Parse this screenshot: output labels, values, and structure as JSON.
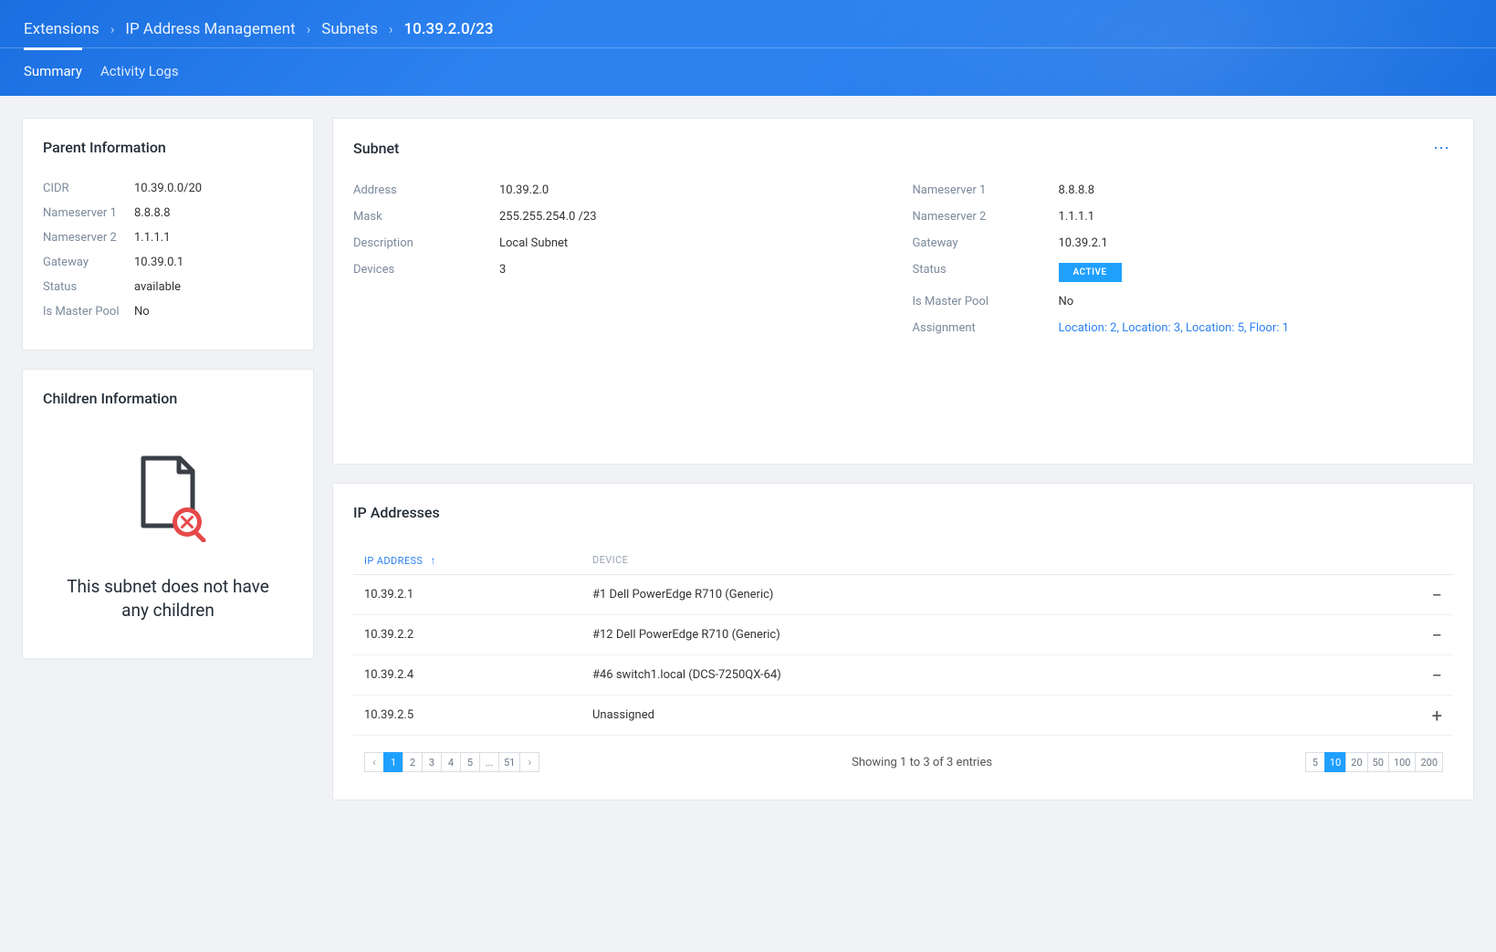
{
  "breadcrumbs": {
    "items": [
      "Extensions",
      "IP Address Management",
      "Subnets",
      "10.39.2.0/23"
    ]
  },
  "tabs": {
    "summary": "Summary",
    "activity": "Activity Logs"
  },
  "parent": {
    "title": "Parent Information",
    "rows": {
      "cidr_label": "CIDR",
      "cidr_value": "10.39.0.0/20",
      "ns1_label": "Nameserver 1",
      "ns1_value": "8.8.8.8",
      "ns2_label": "Nameserver 2",
      "ns2_value": "1.1.1.1",
      "gw_label": "Gateway",
      "gw_value": "10.39.0.1",
      "status_label": "Status",
      "status_value": "available",
      "master_label": "Is Master Pool",
      "master_value": "No"
    }
  },
  "children": {
    "title": "Children Information",
    "empty_line1": "This subnet does not have",
    "empty_line2": "any children"
  },
  "subnet": {
    "title": "Subnet",
    "left": {
      "address_label": "Address",
      "address_value": "10.39.2.0",
      "mask_label": "Mask",
      "mask_value": "255.255.254.0 /23",
      "desc_label": "Description",
      "desc_value": "Local Subnet",
      "devices_label": "Devices",
      "devices_value": "3"
    },
    "right": {
      "ns1_label": "Nameserver 1",
      "ns1_value": "8.8.8.8",
      "ns2_label": "Nameserver 2",
      "ns2_value": "1.1.1.1",
      "gw_label": "Gateway",
      "gw_value": "10.39.2.1",
      "status_label": "Status",
      "status_value": "ACTIVE",
      "master_label": "Is Master Pool",
      "master_value": "No",
      "assign_label": "Assignment",
      "assign_value": "Location: 2, Location: 3, Location: 5, Floor: 1"
    }
  },
  "ips": {
    "title": "IP Addresses",
    "col_ip": "IP ADDRESS",
    "col_device": "DEVICE",
    "rows": [
      {
        "ip": "10.39.2.1",
        "device": "#1 Dell PowerEdge R710 (Generic)",
        "action": "remove"
      },
      {
        "ip": "10.39.2.2",
        "device": "#12 Dell PowerEdge R710 (Generic)",
        "action": "remove"
      },
      {
        "ip": "10.39.2.4",
        "device": "#46 switch1.local (DCS-7250QX-64)",
        "action": "remove"
      },
      {
        "ip": "10.39.2.5",
        "device": "Unassigned",
        "action": "add"
      }
    ],
    "pages": [
      "1",
      "2",
      "3",
      "4",
      "5",
      "...",
      "51"
    ],
    "active_page": "1",
    "showing": "Showing 1 to 3 of 3 entries",
    "sizes": [
      "5",
      "10",
      "20",
      "50",
      "100",
      "200"
    ],
    "active_size": "10"
  }
}
